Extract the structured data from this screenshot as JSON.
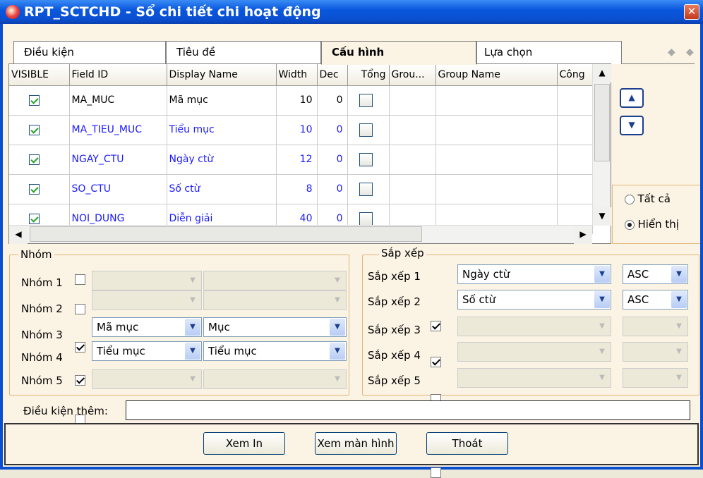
{
  "window": {
    "title": "RPT_SCTCHD - Sổ chi tiết chi hoạt động",
    "close": "✕"
  },
  "tabs": [
    {
      "label": "Điều kiện"
    },
    {
      "label": "Tiêu đề"
    },
    {
      "label": "Cấu hình"
    },
    {
      "label": "Lựa chọn"
    }
  ],
  "tab_nav": {
    "prev": "◆",
    "next": "◆"
  },
  "grid": {
    "columns": [
      "VISIBLE",
      "Field ID",
      "Display Name",
      "Width",
      "Dec",
      "Tổng",
      "Grou...",
      "Group Name",
      "Công"
    ],
    "rows": [
      {
        "visible": true,
        "field_id": "MA_MUC",
        "display_name": "Mã mục",
        "width": "10",
        "dec": "0",
        "tong": false
      },
      {
        "visible": true,
        "field_id": "MA_TIEU_MUC",
        "display_name": "Tiểu mục",
        "width": "10",
        "dec": "0",
        "tong": false
      },
      {
        "visible": true,
        "field_id": "NGAY_CTU",
        "display_name": "Ngày ctừ",
        "width": "12",
        "dec": "0",
        "tong": false
      },
      {
        "visible": true,
        "field_id": "SO_CTU",
        "display_name": "Số ctừ",
        "width": "8",
        "dec": "0",
        "tong": false
      },
      {
        "visible": true,
        "field_id": "NOI_DUNG",
        "display_name": "Diễn giải",
        "width": "40",
        "dec": "0",
        "tong": false
      }
    ]
  },
  "side": {
    "up_icon": "up-arrow",
    "down_icon": "down-arrow",
    "radio_all": "Tất cả",
    "radio_shown": "Hiển thị"
  },
  "nhom": {
    "legend": "Nhóm",
    "rows": [
      {
        "label": "Nhóm 1",
        "checked": false,
        "c1": "",
        "c2": ""
      },
      {
        "label": "Nhóm 2",
        "checked": false,
        "c1": "",
        "c2": ""
      },
      {
        "label": "Nhóm 3",
        "checked": true,
        "c1": "Mã mục",
        "c2": "Mục"
      },
      {
        "label": "Nhóm 4",
        "checked": true,
        "c1": "Tiểu mục",
        "c2": "Tiểu mục"
      },
      {
        "label": "Nhóm 5",
        "checked": false,
        "c1": "",
        "c2": ""
      }
    ]
  },
  "sapxep": {
    "legend": "Sắp xếp",
    "rows": [
      {
        "label": "Sắp xếp 1",
        "checked": true,
        "field": "Ngày ctừ",
        "order": "ASC"
      },
      {
        "label": "Sắp xếp 2",
        "checked": true,
        "field": "Số ctừ",
        "order": "ASC"
      },
      {
        "label": "Sắp xếp 3",
        "checked": false,
        "field": "",
        "order": ""
      },
      {
        "label": "Sắp xếp 4",
        "checked": false,
        "field": "",
        "order": ""
      },
      {
        "label": "Sắp xếp 5",
        "checked": false,
        "field": "",
        "order": ""
      }
    ]
  },
  "dieukien": {
    "label": "Điều kiện thêm:",
    "value": ""
  },
  "buttons": {
    "print": "Xem In",
    "screen": "Xem màn hình",
    "exit": "Thoát"
  }
}
